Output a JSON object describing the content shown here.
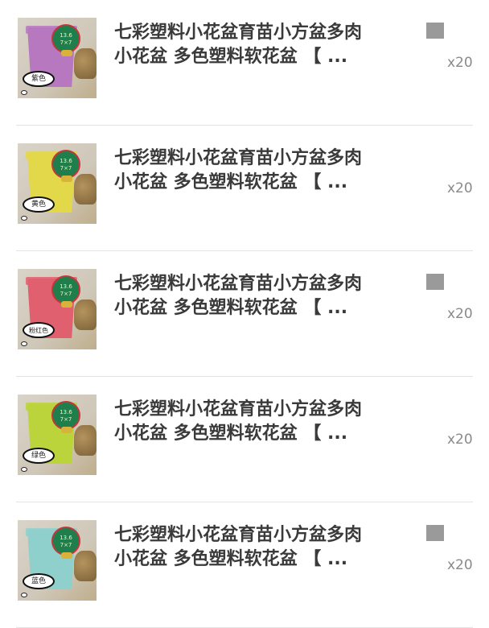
{
  "items": [
    {
      "title_line1": "七彩塑料小花盆育苗小方盆多肉",
      "title_line2": "小花盆 多色塑料软花盆 【 ...",
      "color_tag": "紫色",
      "badge_text": "13.6 7×7",
      "quantity": "x20",
      "pot_color": "#b878c0",
      "show_checkbox": true
    },
    {
      "title_line1": "七彩塑料小花盆育苗小方盆多肉",
      "title_line2": "小花盆 多色塑料软花盆 【 ...",
      "color_tag": "黄色",
      "badge_text": "13.6 7×7",
      "quantity": "x20",
      "pot_color": "#e3d84a",
      "show_checkbox": false
    },
    {
      "title_line1": "七彩塑料小花盆育苗小方盆多肉",
      "title_line2": "小花盆 多色塑料软花盆 【 ...",
      "color_tag": "粉红色",
      "badge_text": "13.6 7×7",
      "quantity": "x20",
      "pot_color": "#e06070",
      "show_checkbox": true
    },
    {
      "title_line1": "七彩塑料小花盆育苗小方盆多肉",
      "title_line2": "小花盆 多色塑料软花盆 【 ...",
      "color_tag": "绿色",
      "badge_text": "13.6 7×7",
      "quantity": "x20",
      "pot_color": "#bcd43c",
      "show_checkbox": false
    },
    {
      "title_line1": "七彩塑料小花盆育苗小方盆多肉",
      "title_line2": "小花盆 多色塑料软花盆 【 ...",
      "color_tag": "蓝色",
      "badge_text": "13.6 7×7",
      "quantity": "x20",
      "pot_color": "#8fd0cc",
      "show_checkbox": true
    }
  ]
}
